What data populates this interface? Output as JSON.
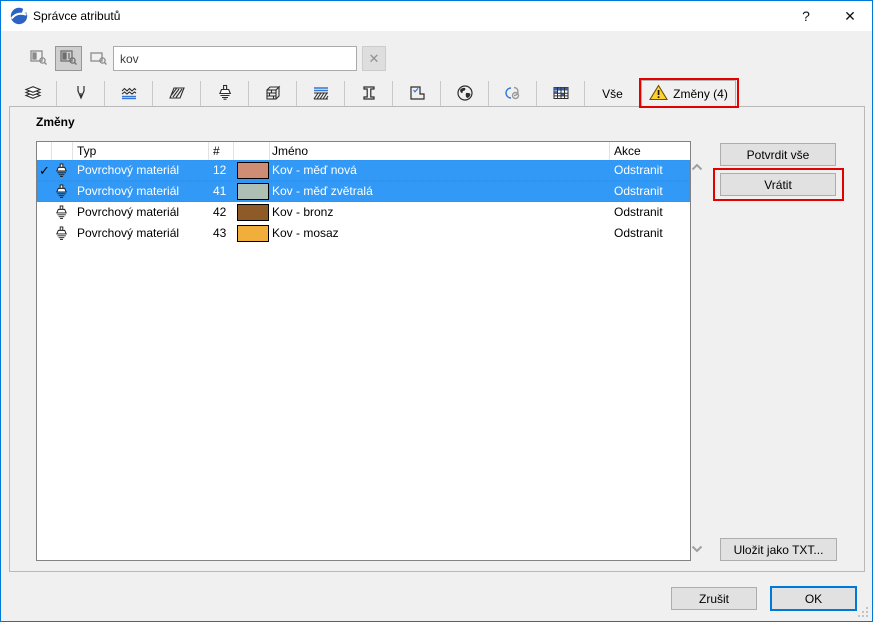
{
  "window": {
    "title": "Správce atributů",
    "help_label": "?",
    "close_label": "✕"
  },
  "toolbar": {
    "search_value": "kov",
    "clear_label": "✕",
    "filter_icons": [
      "search-by-index-icon",
      "search-by-index-and-name-icon",
      "search-by-name-icon"
    ]
  },
  "tabs": {
    "icon_tabs": [
      {
        "icon": "layers-icon"
      },
      {
        "icon": "pens-icon"
      },
      {
        "icon": "line-types-icon"
      },
      {
        "icon": "fill-types-icon"
      },
      {
        "icon": "surfaces-icon"
      },
      {
        "icon": "building-materials-icon"
      },
      {
        "icon": "composites-icon"
      },
      {
        "icon": "profiles-icon"
      },
      {
        "icon": "zone-categories-icon"
      },
      {
        "icon": "cities-icon"
      },
      {
        "icon": "operation-profiles-icon"
      },
      {
        "icon": "mep-systems-icon"
      }
    ],
    "all_label": "Vše",
    "changes_label": "Změny (4)",
    "changes_icon": "warning-triangle-icon"
  },
  "panel": {
    "title": "Změny",
    "table": {
      "headers": {
        "typ": "Typ",
        "num": "#",
        "jmeno": "Jméno",
        "akce": "Akce"
      },
      "rows": [
        {
          "check": "✓",
          "typ": "Povrchový materiál",
          "num": "12",
          "color": "#d08d76",
          "jmeno": "Kov - měď nová",
          "akce": "Odstranit",
          "selected": true
        },
        {
          "check": "",
          "typ": "Povrchový materiál",
          "num": "41",
          "color": "#adc0b3",
          "jmeno": "Kov - měď zvětralá",
          "akce": "Odstranit",
          "selected": true
        },
        {
          "check": "",
          "typ": "Povrchový materiál",
          "num": "42",
          "color": "#8d5a28",
          "jmeno": "Kov - bronz",
          "akce": "Odstranit",
          "selected": false
        },
        {
          "check": "",
          "typ": "Povrchový materiál",
          "num": "43",
          "color": "#f1ae3a",
          "jmeno": "Kov - mosaz",
          "akce": "Odstranit",
          "selected": false
        }
      ]
    },
    "buttons": {
      "confirm_all": "Potvrdit vše",
      "revert": "Vrátit",
      "save_txt": "Uložit jako TXT..."
    }
  },
  "footer": {
    "cancel": "Zrušit",
    "ok": "OK"
  },
  "colors": {
    "selection_blue": "#3399f7",
    "window_border_blue": "#0078d7",
    "annotation_red": "#e30000",
    "warning_yellow": "#ffd02e",
    "swatch_copper_new": "#d08d76",
    "swatch_copper_weathered": "#adc0b3",
    "swatch_bronze": "#8d5a28",
    "swatch_brass": "#f1ae3a"
  }
}
